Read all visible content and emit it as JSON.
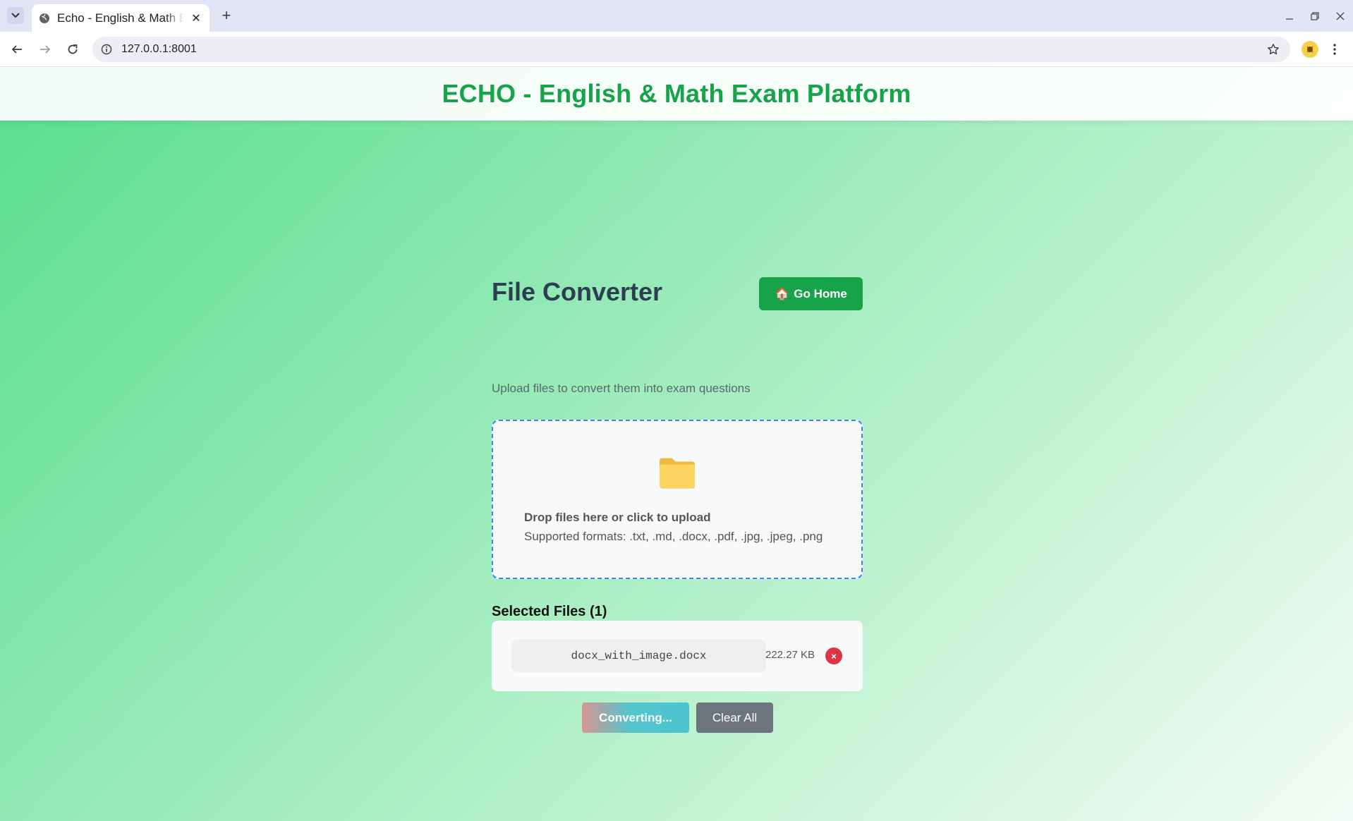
{
  "browser": {
    "tab_title": "Echo - English & Math Exam Platform",
    "url": "127.0.0.1:8001",
    "icons": {
      "tab_list": "chevron-down-icon",
      "favicon": "globe-icon",
      "tab_close": "close-icon",
      "new_tab": "plus-icon",
      "back": "back-arrow-icon",
      "forward": "forward-arrow-icon",
      "reload": "reload-icon",
      "site_info": "info-icon",
      "bookmark": "star-icon",
      "extension": "extension-icon",
      "menu": "kebab-menu-icon",
      "minimize": "minimize-icon",
      "restore": "restore-icon",
      "close_window": "close-window-icon"
    },
    "glyphs": {
      "tab_close": "✕",
      "new_tab": "+"
    }
  },
  "header": {
    "title": "ECHO - English & Math Exam Platform"
  },
  "converter": {
    "title": "File Converter",
    "subtitle": "Upload files to convert them into exam questions",
    "home_icon": "🏠",
    "home_label": "Go Home",
    "dropzone": {
      "icon": "folder-icon",
      "text": "Drop files here or click to upload",
      "formats": "Supported formats: .txt, .md, .docx, .pdf, .jpg, .jpeg, .png"
    },
    "files_heading": "Selected Files (1)",
    "files": [
      {
        "name": "docx_with_image.docx",
        "size": "222.27 KB",
        "remove_glyph": "×"
      }
    ],
    "convert_label": "Converting...",
    "clear_label": "Clear All"
  },
  "colors": {
    "brand_green": "#16a34a",
    "dropzone_border": "#3b82f6",
    "remove_red": "#dc3545",
    "clear_gray": "#6c757d"
  }
}
